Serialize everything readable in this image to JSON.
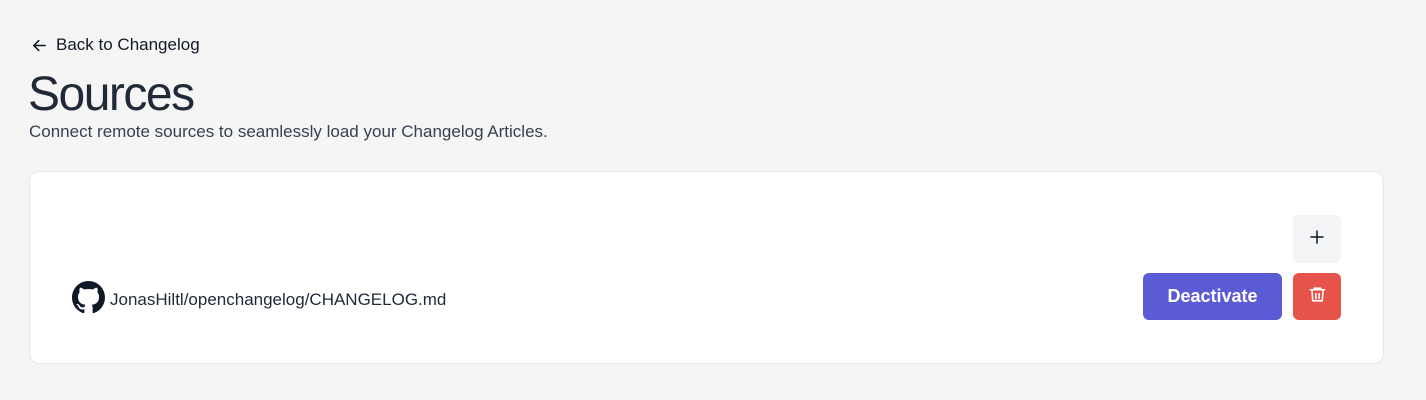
{
  "header": {
    "back_label": "Back to Changelog",
    "title": "Sources",
    "subtitle": "Connect remote sources to seamlessly load your Changelog Articles."
  },
  "sources": [
    {
      "provider_icon": "github-icon",
      "name": "JonasHiltl/openchangelog/CHANGELOG.md",
      "action_label": "Deactivate"
    }
  ],
  "icons": {
    "back": "arrow-left-icon",
    "add": "plus-icon",
    "delete": "trash-icon"
  },
  "colors": {
    "background": "#f5f5f5",
    "card": "#ffffff",
    "primary_button": "#5b5bd6",
    "danger_button": "#e5534b",
    "add_button": "#f3f4f6"
  }
}
